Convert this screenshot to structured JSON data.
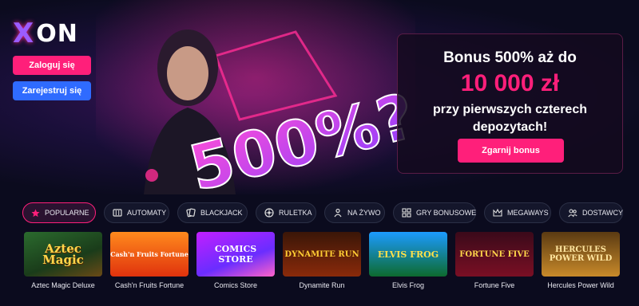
{
  "logo": {
    "x": "X",
    "on": "ON"
  },
  "auth": {
    "login": "Zaloguj się",
    "register": "Zarejestruj się"
  },
  "hero_art": {
    "text": "500%?"
  },
  "promo": {
    "line1": "Bonus 500% aż do",
    "amount": "10 000 zł",
    "line3": "przy pierwszych czterech",
    "line4": "depozytach!",
    "button": "Zgarnij bonus"
  },
  "categories": [
    {
      "label": "POPULARNE",
      "icon": "star-icon",
      "active": true
    },
    {
      "label": "AUTOMATY",
      "icon": "slot-machine-icon",
      "active": false
    },
    {
      "label": "BLACKJACK",
      "icon": "cards-icon",
      "active": false
    },
    {
      "label": "RULETKA",
      "icon": "roulette-icon",
      "active": false
    },
    {
      "label": "NA ŻYWO",
      "icon": "live-icon",
      "active": false
    },
    {
      "label": "GRY BONUSOWE",
      "icon": "bonus-icon",
      "active": false
    },
    {
      "label": "MEGAWAYS",
      "icon": "crown-icon",
      "active": false
    },
    {
      "label": "DOSTAWCY",
      "icon": "providers-icon",
      "active": false
    }
  ],
  "games": [
    {
      "name": "Aztec Magic Deluxe",
      "thumb_text": "Aztec Magic"
    },
    {
      "name": "Cash'n Fruits Fortune",
      "thumb_text": "Cash'n Fruits Fortune"
    },
    {
      "name": "Comics Store",
      "thumb_text": "COMICS STORE"
    },
    {
      "name": "Dynamite Run",
      "thumb_text": "DYNAMITE RUN"
    },
    {
      "name": "Elvis Frog",
      "thumb_text": "ELVIS FROG"
    },
    {
      "name": "Fortune Five",
      "thumb_text": "FORTUNE FIVE"
    },
    {
      "name": "Hercules Power Wild",
      "thumb_text": "HERCULES POWER WILD"
    }
  ],
  "colors": {
    "accent": "#ff1f7a",
    "secondary": "#2f6bff",
    "background": "#0b0b1e"
  }
}
